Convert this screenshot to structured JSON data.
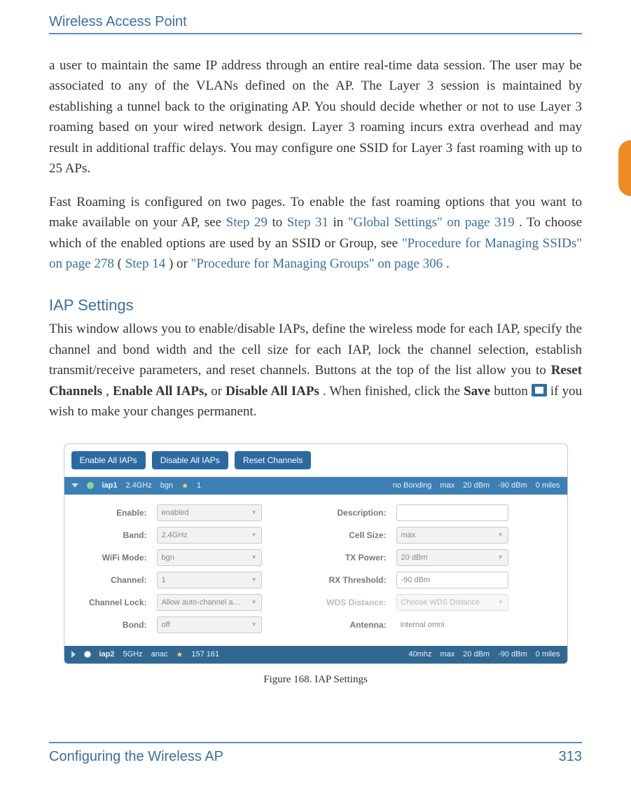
{
  "header": {
    "title": "Wireless Access Point"
  },
  "para1": {
    "text": "a user to maintain the same IP address through an entire real-time data session. The user may be associated to any of the VLANs defined on the AP. The Layer 3 session is maintained by establishing a tunnel back to the originating AP. You should decide whether or not to use Layer 3 roaming based on your wired network design. Layer 3 roaming incurs extra overhead and may result in additional traffic delays. You may configure one SSID for Layer 3 fast roaming with up to 25 APs."
  },
  "para2": {
    "lead": "Fast Roaming is configured on two pages. To enable the fast roaming options that you want to make available on your AP, see ",
    "link_step29": "Step 29",
    "to_word": " to ",
    "link_step31": "Step 31",
    "in_word": " in ",
    "link_global": "\"Global Settings\" on page 319",
    "mid": ". To choose which of the enabled options are used by an SSID or Group, see ",
    "link_ssid": "\"Procedure for Managing SSIDs\" on page 278",
    "paren_open": " (",
    "link_step14": "Step 14",
    "paren_close": ") or ",
    "link_groups": "\"Procedure for Managing Groups\" on page 306",
    "tail": "."
  },
  "section": {
    "title": "IAP Settings"
  },
  "para3": {
    "lead": "This window allows you to enable/disable IAPs, define the wireless mode for each IAP, specify the channel and bond width and the cell size for each IAP, lock the channel selection, establish transmit/receive parameters, and reset channels. Buttons at the top of the list allow you to ",
    "b_reset": "Reset Channels",
    "sep1": ", ",
    "b_enable": "Enable All IAPs,",
    "sep2": " or ",
    "b_disable": "Disable All IAPs",
    "sep3": ". When finished, click the ",
    "b_save": "Save",
    "sep4": " button ",
    "tail": " if you wish to make your changes permanent."
  },
  "figure": {
    "toolbar": {
      "enable_all": "Enable All IAPs",
      "disable_all": "Disable All IAPs",
      "reset": "Reset Channels"
    },
    "row1": {
      "iap": "iap1",
      "band": "2.4GHz",
      "mode": "bgn",
      "ch": "1",
      "bond": "no Bonding",
      "cell": "max",
      "tx": "20 dBm",
      "rx": "-90 dBm",
      "dist": "0 miles"
    },
    "row2": {
      "iap": "iap2",
      "band": "5GHz",
      "mode": "anac",
      "ch": "157 161",
      "bond": "40mhz",
      "cell": "max",
      "tx": "20 dBm",
      "rx": "-90 dBm",
      "dist": "0 miles"
    },
    "form": {
      "left": {
        "enable_lbl": "Enable:",
        "enable_val": "enabled",
        "band_lbl": "Band:",
        "band_val": "2.4GHz",
        "wifi_lbl": "WiFi Mode:",
        "wifi_val": "bgn",
        "channel_lbl": "Channel:",
        "channel_val": "1",
        "lock_lbl": "Channel Lock:",
        "lock_val": "Allow auto-channel a…",
        "bond_lbl": "Bond:",
        "bond_val": "off"
      },
      "right": {
        "desc_lbl": "Description:",
        "desc_val": "",
        "cell_lbl": "Cell Size:",
        "cell_val": "max",
        "txp_lbl": "TX Power:",
        "txp_val": "20 dBm",
        "rxt_lbl": "RX Threshold:",
        "rxt_val": "-90 dBm",
        "wds_lbl": "WDS Distance:",
        "wds_val": "Choose WDS Distance",
        "ant_lbl": "Antenna:",
        "ant_val": "internal omni"
      }
    },
    "caption": "Figure 168. IAP Settings"
  },
  "footer": {
    "left": "Configuring the Wireless AP",
    "page": "313"
  }
}
